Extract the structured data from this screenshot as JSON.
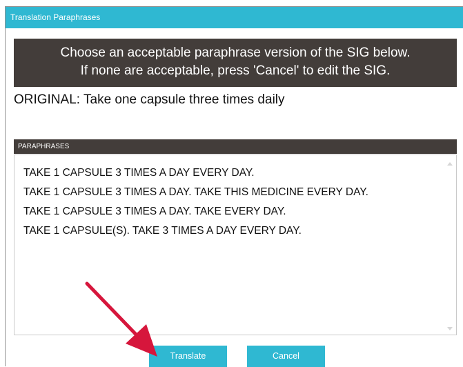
{
  "window": {
    "title": "Translation Paraphrases"
  },
  "instructions": {
    "line1": "Choose an acceptable paraphrase version of the SIG below.",
    "line2": "If none are acceptable, press 'Cancel' to edit the SIG."
  },
  "original": {
    "text": "ORIGINAL: Take one capsule three times daily"
  },
  "paraphrases": {
    "header": "PARAPHRASES",
    "items": [
      "TAKE 1 CAPSULE 3 TIMES A DAY EVERY DAY.",
      "TAKE 1 CAPSULE 3 TIMES A DAY. TAKE THIS MEDICINE EVERY DAY.",
      "TAKE 1 CAPSULE 3 TIMES A DAY. TAKE EVERY DAY.",
      "TAKE 1 CAPSULE(S). TAKE 3 TIMES A DAY EVERY DAY."
    ]
  },
  "buttons": {
    "translate_label": "Translate",
    "cancel_label": "Cancel"
  },
  "colors": {
    "accent": "#2fb8d2",
    "dark_panel": "#433d3a",
    "annotation_arrow": "#d6163c"
  },
  "icons": {
    "annotation": "arrow-pointer-icon",
    "scroll_up": "scroll-up-icon",
    "scroll_down": "scroll-down-icon"
  }
}
